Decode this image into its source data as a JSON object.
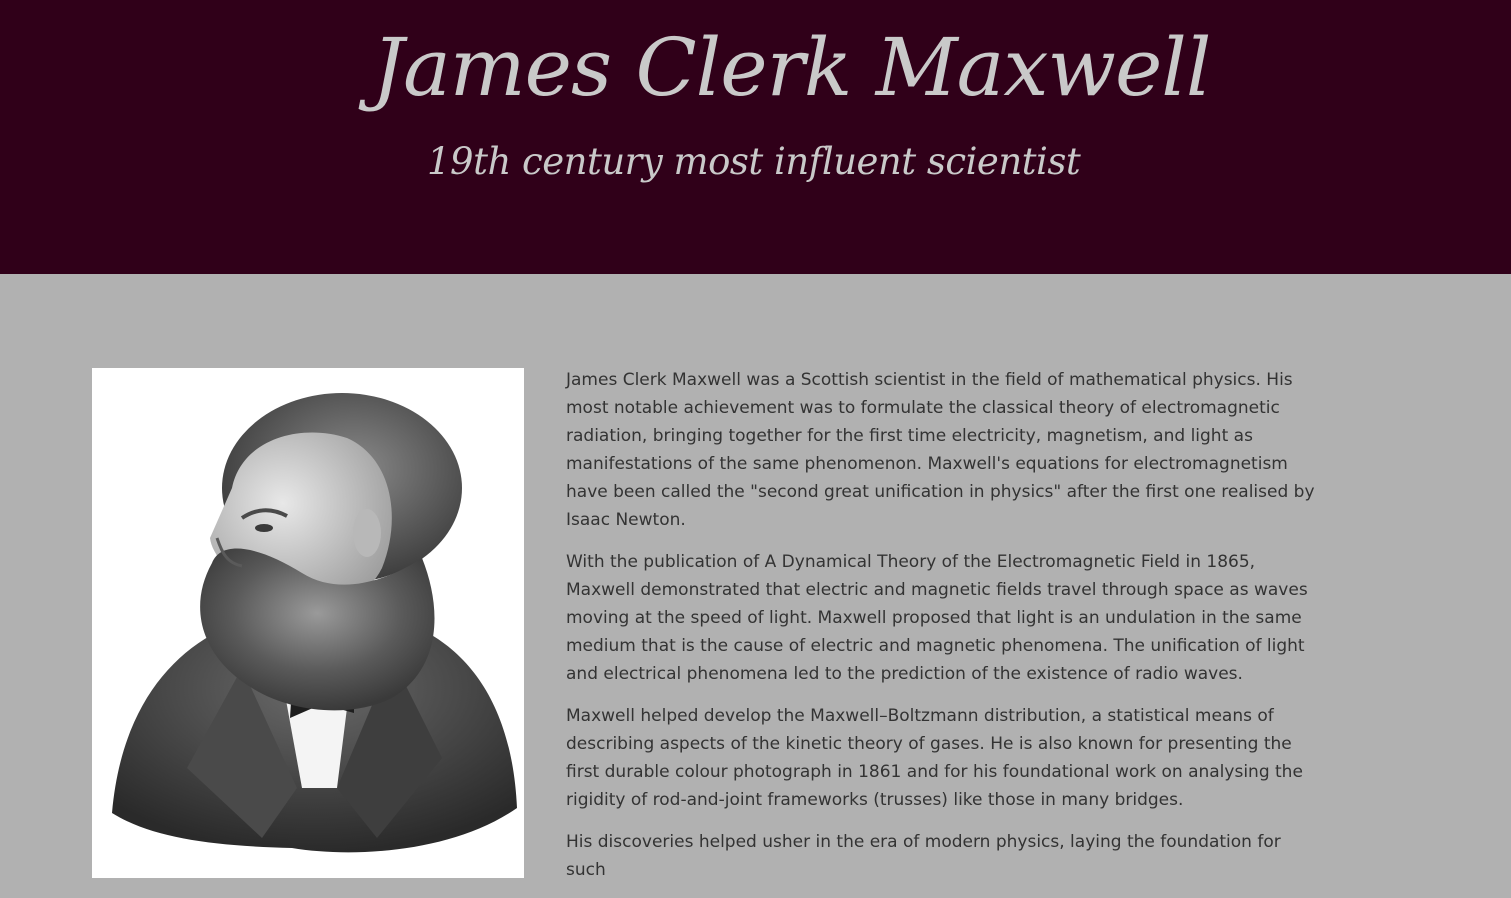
{
  "header": {
    "title": "James Clerk Maxwell",
    "subtitle": "19th century most influent scientist"
  },
  "portrait": {
    "icon": "portrait-engraving"
  },
  "bio": {
    "paragraphs": [
      "James Clerk Maxwell was a Scottish scientist in the field of mathematical physics. His most notable achievement was to formulate the classical theory of electromagnetic radiation, bringing together for the first time electricity, magnetism, and light as manifestations of the same phenomenon. Maxwell's equations for electromagnetism have been called the \"second great unification in physics\" after the first one realised by Isaac Newton.",
      "With the publication of A Dynamical Theory of the Electromagnetic Field in 1865, Maxwell demonstrated that electric and magnetic fields travel through space as waves moving at the speed of light. Maxwell proposed that light is an undulation in the same medium that is the cause of electric and magnetic phenomena. The unification of light and electrical phenomena led to the prediction of the existence of radio waves.",
      "Maxwell helped develop the Maxwell–Boltzmann distribution, a statistical means of describing aspects of the kinetic theory of gases. He is also known for presenting the first durable colour photograph in 1861 and for his foundational work on analysing the rigidity of rod-and-joint frameworks (trusses) like those in many bridges.",
      "His discoveries helped usher in the era of modern physics, laying the foundation for such"
    ]
  },
  "colors": {
    "header_bg": "#300019",
    "title_color": "#c9c9c9",
    "page_bg": "#b1b1b1",
    "text_color": "#333333"
  }
}
